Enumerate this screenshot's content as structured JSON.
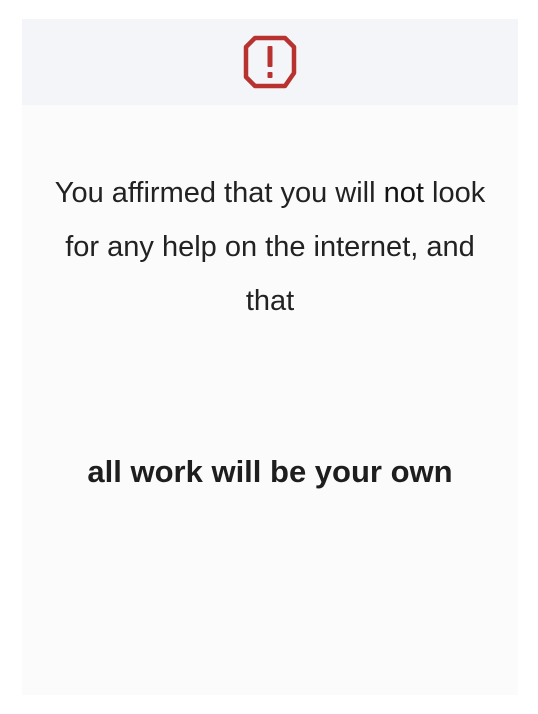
{
  "header": {
    "icon": "exclamation-alert-icon",
    "icon_color": "#b8322f"
  },
  "body": {
    "message_part1": "You affirmed that you will ",
    "message_emphasis": "not",
    "message_part2": " look for any help on the internet, and that",
    "statement": "all work will be your own"
  }
}
